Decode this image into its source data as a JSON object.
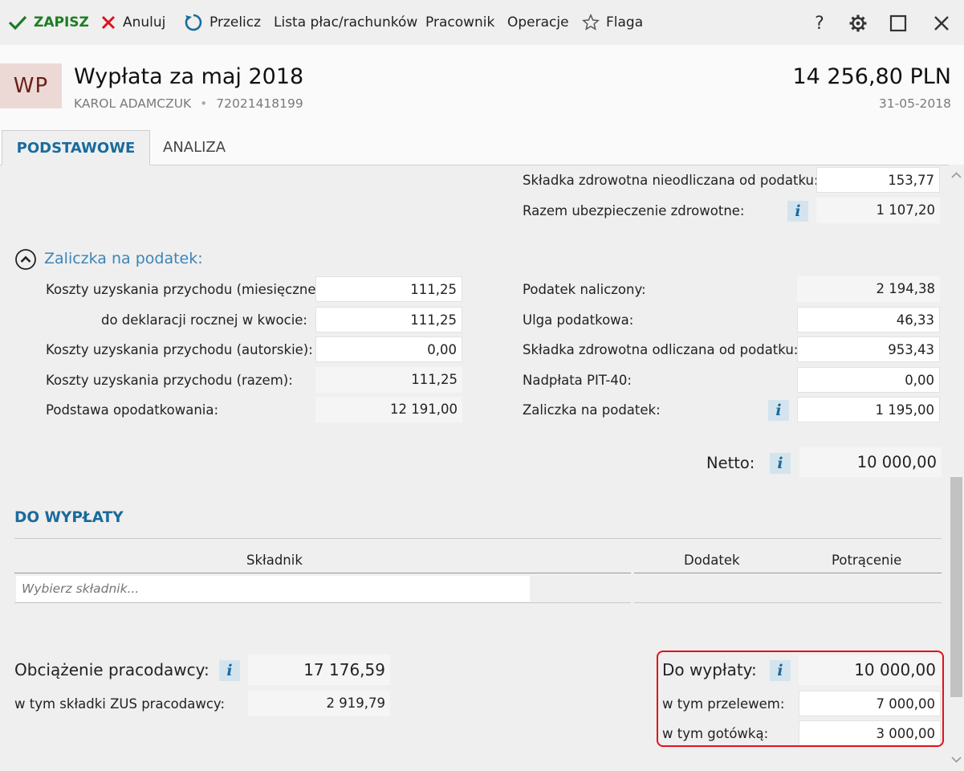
{
  "toolbar": {
    "save_label": "ZAPISZ",
    "cancel_label": "Anuluj",
    "recalc_label": "Przelicz",
    "payroll_list_label": "Lista płac/rachunków",
    "employee_label": "Pracownik",
    "operations_label": "Operacje",
    "flag_label": "Flaga",
    "help_label": "?"
  },
  "header": {
    "avatar_initials": "WP",
    "title": "Wypłata za maj 2018",
    "employee_name": "KAROL ADAMCZUK",
    "separator": "•",
    "employee_id": "72021418199",
    "amount": "14 256,80 PLN",
    "date": "31-05-2018"
  },
  "tabs": [
    {
      "label": "PODSTAWOWE",
      "active": true
    },
    {
      "label": "ANALIZA",
      "active": false
    }
  ],
  "health": {
    "non_deductible_label": "Składka zdrowotna nieodliczana od podatku:",
    "non_deductible_value": "153,77",
    "total_label": "Razem ubezpieczenie zdrowotne:",
    "total_value": "1 107,20"
  },
  "tax": {
    "section_label": "Zaliczka na podatek:",
    "left": [
      {
        "label": "Koszty uzyskania przychodu (miesięczne):",
        "value": "111,25"
      },
      {
        "label": "do deklaracji rocznej w kwocie:",
        "value": "111,25"
      },
      {
        "label": "Koszty uzyskania przychodu (autorskie):",
        "value": "0,00"
      },
      {
        "label": "Koszty uzyskania przychodu (razem):",
        "value": "111,25"
      },
      {
        "label": "Podstawa opodatkowania:",
        "value": "12 191,00"
      }
    ],
    "right": [
      {
        "label": "Podatek naliczony:",
        "value": "2 194,38"
      },
      {
        "label": "Ulga podatkowa:",
        "value": "46,33"
      },
      {
        "label": "Składka zdrowotna odliczana od podatku:",
        "value": "953,43"
      },
      {
        "label": "Nadpłata PIT-40:",
        "value": "0,00"
      },
      {
        "label": "Zaliczka na podatek:",
        "value": "1 195,00"
      }
    ],
    "net_label": "Netto:",
    "net_value": "10 000,00"
  },
  "payout": {
    "section_title": "DO WYPŁATY",
    "col_component": "Składnik",
    "col_bonus": "Dodatek",
    "col_deduction": "Potrącenie",
    "component_placeholder": "Wybierz składnik...",
    "employer_cost_label": "Obciążenie pracodawcy:",
    "employer_cost_value": "17 176,59",
    "employer_zus_label": "w tym składki ZUS pracodawcy:",
    "employer_zus_value": "2 919,79",
    "to_pay_label": "Do wypłaty:",
    "to_pay_value": "10 000,00",
    "transfer_label": "w tym przelewem:",
    "transfer_value": "7 000,00",
    "cash_label": "w tym gotówką:",
    "cash_value": "3 000,00"
  },
  "info_glyph": "i",
  "colors": {
    "accent": "#1a6b9c",
    "save": "#1c7d22",
    "cancel": "#e0121c",
    "highlight": "#e0121c"
  }
}
